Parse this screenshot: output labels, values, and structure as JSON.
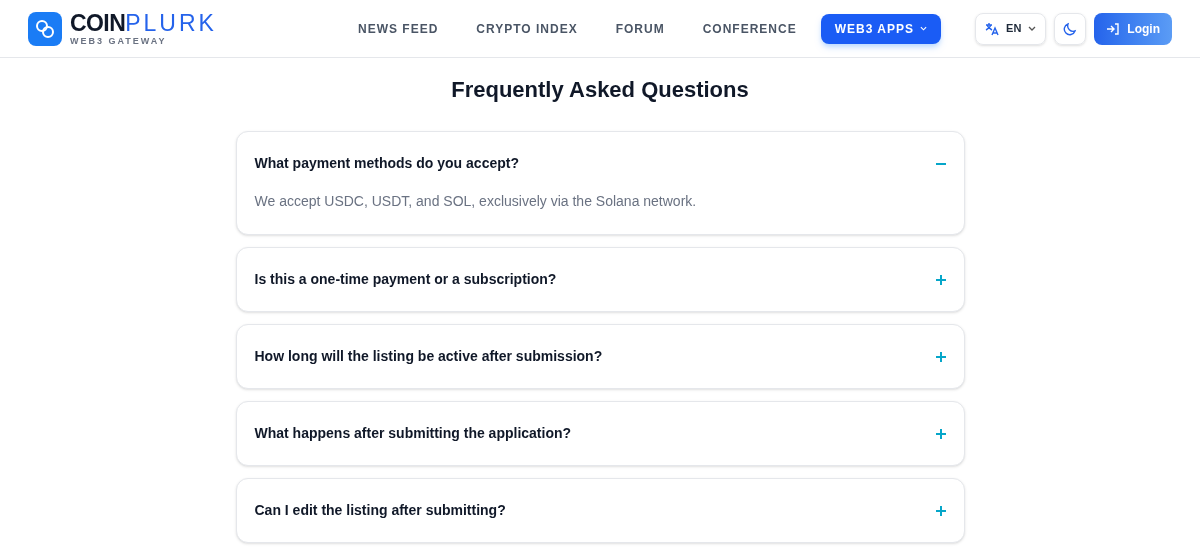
{
  "brand": {
    "name_bold": "COIN",
    "name_light": "PLURK",
    "tagline": "WEB3 GATEWAY"
  },
  "nav": [
    {
      "label": "NEWS FEED",
      "selected": false
    },
    {
      "label": "CRYPTO INDEX",
      "selected": false
    },
    {
      "label": "FORUM",
      "selected": false
    },
    {
      "label": "CONFERENCE",
      "selected": false
    },
    {
      "label": "WEB3 APPS",
      "selected": true
    }
  ],
  "language": "EN",
  "login": "Login",
  "title": "Frequently Asked Questions",
  "faq": [
    {
      "question": "What payment methods do you accept?",
      "expanded": true,
      "answer": "We accept USDC, USDT, and SOL, exclusively via the Solana network."
    },
    {
      "question": "Is this a one-time payment or a subscription?",
      "expanded": false
    },
    {
      "question": "How long will the listing be active after submission?",
      "expanded": false
    },
    {
      "question": "What happens after submitting the application?",
      "expanded": false
    },
    {
      "question": "Can I edit the listing after submitting?",
      "expanded": false
    }
  ]
}
